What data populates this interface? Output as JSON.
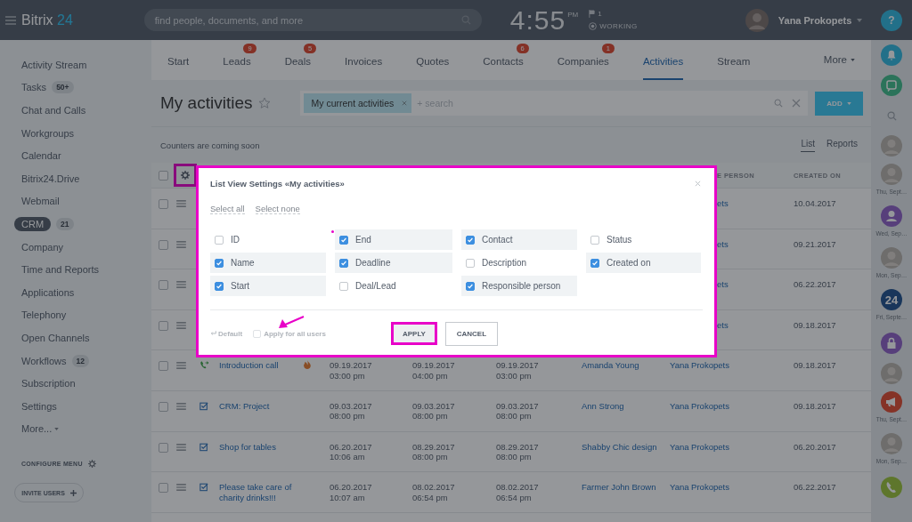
{
  "topbar": {
    "logo": "Bitrix",
    "logo_number": "24",
    "search_placeholder": "find people, documents, and more",
    "time": "4:55",
    "ampm": "PM",
    "flag_count": "1",
    "status": "WORKING",
    "user": "Yana Prokopets"
  },
  "sidebar": {
    "items": [
      {
        "label": "Activity Stream",
        "selected": false
      },
      {
        "label": "Tasks",
        "badge": "50+",
        "selected": false
      },
      {
        "label": "Chat and Calls",
        "selected": false
      },
      {
        "label": "Workgroups",
        "selected": false
      },
      {
        "label": "Calendar",
        "selected": false
      },
      {
        "label": "Bitrix24.Drive",
        "selected": false
      },
      {
        "label": "Webmail",
        "selected": false
      },
      {
        "label": "CRM",
        "badge": "21",
        "selected": true
      },
      {
        "label": "Company",
        "selected": false
      },
      {
        "label": "Time and Reports",
        "selected": false
      },
      {
        "label": "Applications",
        "selected": false
      },
      {
        "label": "Telephony",
        "selected": false
      },
      {
        "label": "Open Channels",
        "selected": false
      },
      {
        "label": "Workflows",
        "badge": "12",
        "selected": false
      },
      {
        "label": "Subscription",
        "selected": false
      },
      {
        "label": "Settings",
        "selected": false
      }
    ],
    "more": "More...",
    "configure": "CONFIGURE MENU",
    "invite": "INVITE USERS"
  },
  "tabs": [
    {
      "label": "Start",
      "selected": false
    },
    {
      "label": "Leads",
      "badge": "9",
      "selected": false
    },
    {
      "label": "Deals",
      "badge": "5",
      "selected": false
    },
    {
      "label": "Invoices",
      "selected": false
    },
    {
      "label": "Quotes",
      "selected": false
    },
    {
      "label": "Contacts",
      "badge": "6",
      "selected": false
    },
    {
      "label": "Companies",
      "badge": "1",
      "selected": false
    },
    {
      "label": "Activities",
      "selected": true
    },
    {
      "label": "Stream",
      "selected": false
    }
  ],
  "more_tab": "More",
  "page_title": "My activities",
  "filter": {
    "chip": "My current activities",
    "placeholder": "+ search"
  },
  "add_button": "ADD",
  "counters_note": "Counters are coming soon",
  "views": [
    {
      "label": "List",
      "selected": true
    },
    {
      "label": "Reports",
      "selected": false
    }
  ],
  "table": {
    "header_checked": false,
    "columns": [
      "E PERSON",
      "CREATED ON"
    ],
    "rows": [
      {
        "checked": false,
        "responsible": "ets",
        "created_on": "10.04.2017"
      },
      {
        "checked": false,
        "responsible": "ets",
        "created_on": "09.21.2017"
      },
      {
        "checked": false,
        "responsible": "ets",
        "created_on": "06.22.2017"
      },
      {
        "checked": false,
        "responsible": "ets",
        "created_on": "09.18.2017"
      },
      {
        "checked": false,
        "kind": "call",
        "name": "Introduction call",
        "hot": true,
        "start": [
          "09.19.2017",
          "03:00 pm"
        ],
        "end": [
          "09.19.2017",
          "04:00 pm"
        ],
        "deadline": [
          "09.19.2017",
          "03:00 pm"
        ],
        "contact": "Amanda Young",
        "responsible": "Yana Prokopets",
        "created_on": "09.18.2017"
      },
      {
        "checked": false,
        "kind": "task",
        "name": "CRM: Project",
        "hot": false,
        "start": [
          "09.03.2017",
          "08:00 pm"
        ],
        "end": [
          "09.03.2017",
          "08:00 pm"
        ],
        "deadline": [
          "09.03.2017",
          "08:00 pm"
        ],
        "contact": "Ann Strong",
        "responsible": "Yana Prokopets",
        "created_on": "09.18.2017"
      },
      {
        "checked": false,
        "kind": "task",
        "name": "Shop for tables",
        "hot": false,
        "start": [
          "06.20.2017",
          "10:06 am"
        ],
        "end": [
          "08.29.2017",
          "08:00 pm"
        ],
        "deadline": [
          "08.29.2017",
          "08:00 pm"
        ],
        "contact": "Shabby Chic design",
        "responsible": "Yana Prokopets",
        "created_on": "06.20.2017"
      },
      {
        "checked": false,
        "kind": "task",
        "name": "Please take care of charity drinks!!!",
        "hot": false,
        "start": [
          "06.20.2017",
          "10:07 am"
        ],
        "end": [
          "08.02.2017",
          "06:54 pm"
        ],
        "deadline": [
          "08.02.2017",
          "06:54 pm"
        ],
        "contact": "Farmer John Brown",
        "responsible": "Yana Prokopets",
        "created_on": "06.22.2017"
      }
    ]
  },
  "rail": [
    {
      "kind": "help",
      "text": "?"
    },
    {
      "kind": "bell"
    },
    {
      "kind": "chat"
    },
    {
      "kind": "search"
    },
    {
      "kind": "avatar"
    },
    {
      "kind": "avatar",
      "caption": "Thu, Sept…"
    },
    {
      "kind": "user",
      "caption": "Wed, Sep…"
    },
    {
      "kind": "avatar",
      "caption": "Mon, Sep…"
    },
    {
      "kind": "logo",
      "text": "24",
      "caption": "Fri, Septe…"
    },
    {
      "kind": "lock"
    },
    {
      "kind": "avatar"
    },
    {
      "kind": "megaphone",
      "caption": "Thu, Sept…"
    },
    {
      "kind": "avatar",
      "caption": "Mon, Sep…"
    },
    {
      "kind": "phone"
    }
  ],
  "dialog": {
    "title": "List View Settings «My activities»",
    "select_all": "Select all",
    "select_none": "Select none",
    "fields": [
      {
        "label": "ID",
        "checked": false
      },
      {
        "label": "End",
        "checked": true
      },
      {
        "label": "Contact",
        "checked": true
      },
      {
        "label": "Status",
        "checked": false
      },
      {
        "label": "Name",
        "checked": true
      },
      {
        "label": "Deadline",
        "checked": true
      },
      {
        "label": "Description",
        "checked": false
      },
      {
        "label": "Created on",
        "checked": true
      },
      {
        "label": "Start",
        "checked": true
      },
      {
        "label": "Deal/Lead",
        "checked": false
      },
      {
        "label": "Responsible person",
        "checked": true
      }
    ],
    "default": "Default",
    "apply_all": {
      "label": "Apply for all users",
      "checked": false
    },
    "apply": "APPLY",
    "cancel": "CANCEL"
  }
}
